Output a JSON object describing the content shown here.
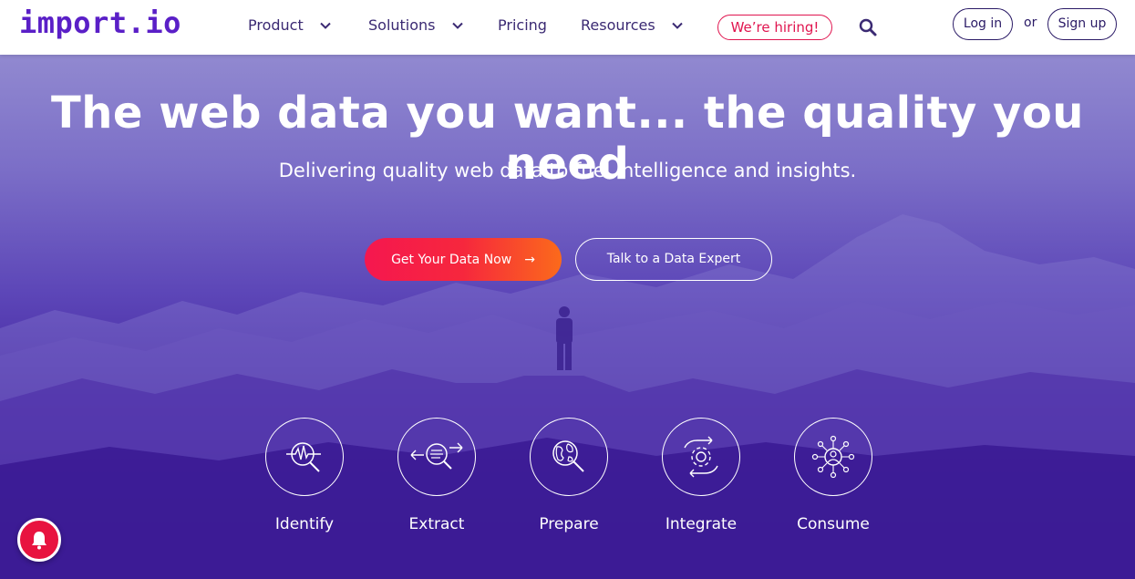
{
  "header": {
    "logo": "import.io",
    "nav": {
      "product": "Product",
      "solutions": "Solutions",
      "pricing": "Pricing",
      "resources": "Resources"
    },
    "hiring": "We’re hiring!",
    "login": "Log in",
    "or": "or",
    "signup": "Sign up"
  },
  "hero": {
    "title": "The web data you want... the quality you need",
    "subtitle": "Delivering quality web data to fuel intelligence and insights.",
    "cta_primary": "Get Your Data Now",
    "cta_primary_arrow": "→",
    "cta_secondary": "Talk to a Data Expert"
  },
  "steps": [
    {
      "label": "Identify",
      "icon": "pulse-magnifier-icon"
    },
    {
      "label": "Extract",
      "icon": "arrows-magnifier-icon"
    },
    {
      "label": "Prepare",
      "icon": "globe-magnifier-icon"
    },
    {
      "label": "Integrate",
      "icon": "gear-cycle-icon"
    },
    {
      "label": "Consume",
      "icon": "person-network-icon"
    }
  ],
  "colors": {
    "brand": "#5a1fc7",
    "hiring": "#e0154f",
    "cta_start": "#f5174f",
    "cta_end": "#fb6a1b",
    "notification": "#e8133f"
  }
}
